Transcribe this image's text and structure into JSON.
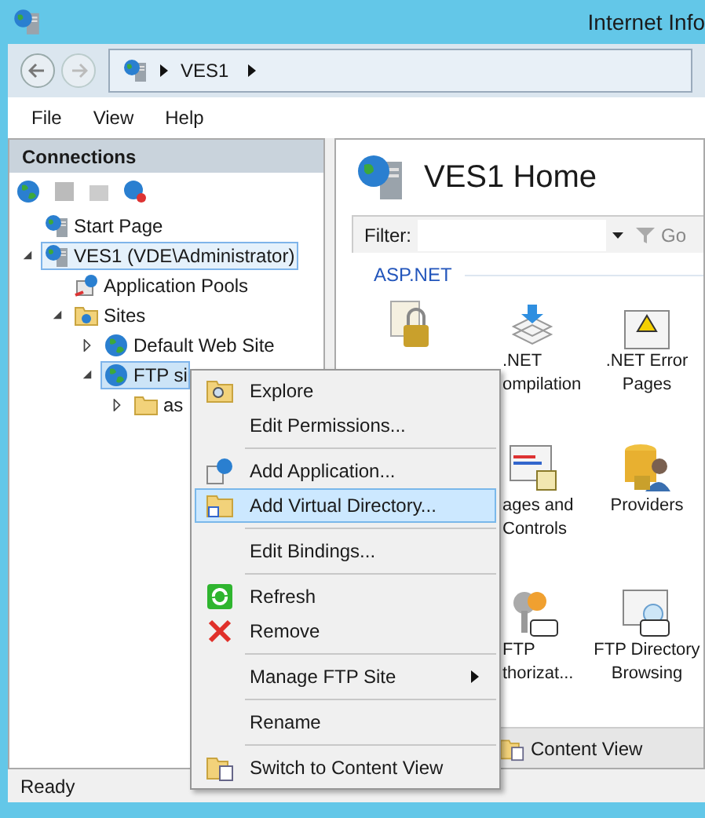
{
  "window": {
    "title": "Internet Info"
  },
  "address": {
    "path": [
      "VES1"
    ]
  },
  "menu_bar": [
    "File",
    "View",
    "Help"
  ],
  "connections": {
    "title": "Connections",
    "tree": [
      {
        "label": "Start Page",
        "selected": false
      },
      {
        "label": "VES1 (VDE\\Administrator)",
        "selected": true,
        "expanded": true,
        "children": [
          {
            "label": "Application Pools",
            "selected": false
          },
          {
            "label": "Sites",
            "selected": false,
            "expanded": true,
            "children": [
              {
                "label": "Default Web Site",
                "selected": false,
                "expanded": false,
                "has_children": true
              },
              {
                "label": "FTP si",
                "selected": true,
                "expanded": true,
                "children": [
                  {
                    "label": "as",
                    "selected": false,
                    "expanded": false,
                    "has_children": true
                  }
                ]
              }
            ]
          }
        ]
      }
    ]
  },
  "home": {
    "title": "VES1 Home",
    "filter": {
      "label": "Filter:",
      "go": "Go"
    },
    "group": "ASP.NET",
    "features": [
      {
        "kind": "icon"
      },
      {
        "kind": "labelled",
        "lines": [
          ".NET",
          "ompilation"
        ]
      },
      {
        "kind": "labelled",
        "lines": [
          ".NET Error",
          "Pages"
        ]
      },
      {
        "kind": "labelled",
        "lines": [
          "ages and",
          "Controls"
        ]
      },
      {
        "kind": "labelled",
        "lines": [
          "Providers"
        ]
      },
      {
        "kind": "labelled",
        "lines": [
          "FTP",
          "thorizat..."
        ]
      },
      {
        "kind": "labelled",
        "lines": [
          "FTP Directory",
          "Browsing"
        ]
      }
    ],
    "view_tab": "Content View"
  },
  "context_menu": [
    {
      "kind": "item",
      "label": "Explore",
      "selected": false
    },
    {
      "kind": "item",
      "label": "Edit Permissions...",
      "selected": false
    },
    {
      "kind": "separator"
    },
    {
      "kind": "item",
      "label": "Add Application...",
      "selected": false
    },
    {
      "kind": "item",
      "label": "Add Virtual Directory...",
      "selected": true
    },
    {
      "kind": "separator"
    },
    {
      "kind": "item",
      "label": "Edit Bindings...",
      "selected": false
    },
    {
      "kind": "separator"
    },
    {
      "kind": "item",
      "label": "Refresh",
      "selected": false
    },
    {
      "kind": "item",
      "label": "Remove",
      "selected": false
    },
    {
      "kind": "separator"
    },
    {
      "kind": "submenu",
      "label": "Manage FTP Site",
      "selected": false
    },
    {
      "kind": "separator"
    },
    {
      "kind": "item",
      "label": "Rename",
      "selected": false
    },
    {
      "kind": "separator"
    },
    {
      "kind": "item",
      "label": "Switch to Content View",
      "selected": false
    }
  ],
  "status_bar": "Ready"
}
